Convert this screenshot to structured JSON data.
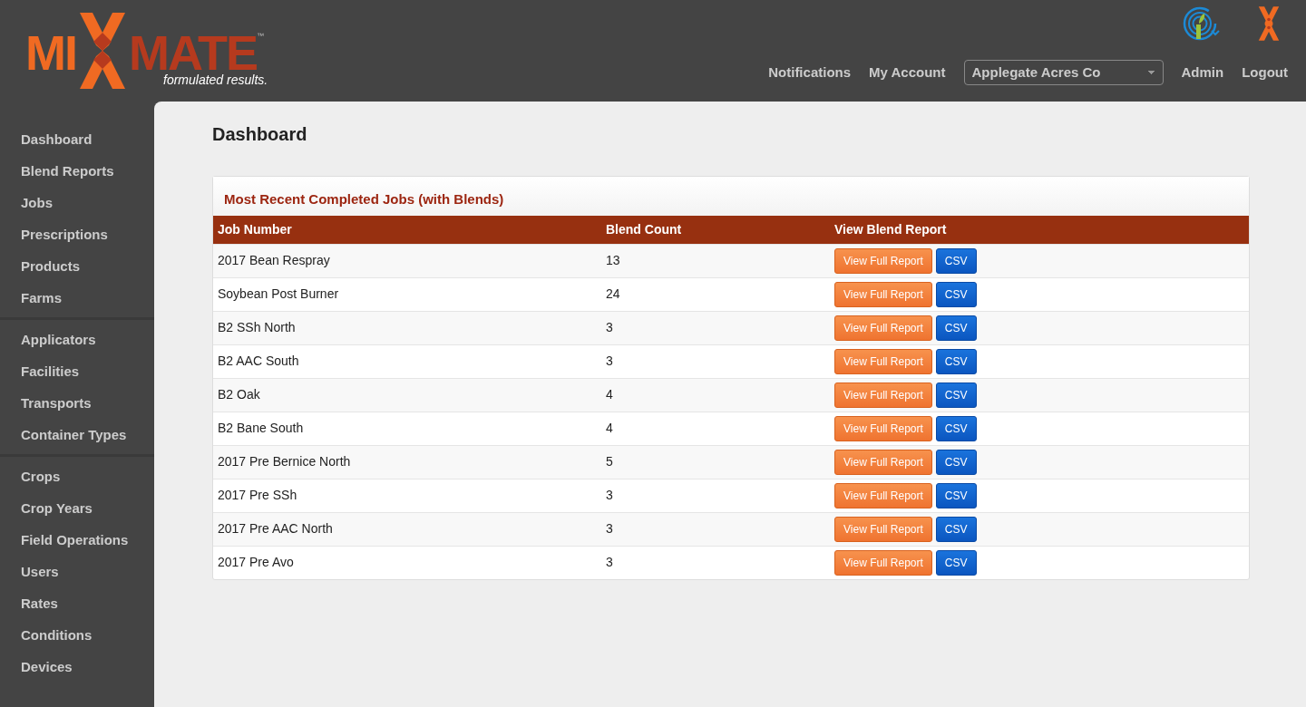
{
  "logo": {
    "left": "MI",
    "right": "MATE",
    "trademark": "™",
    "tagline": "formulated results."
  },
  "top_nav": {
    "links": [
      "Notifications",
      "My Account"
    ],
    "company_select": {
      "value": "Applegate Acres Co"
    },
    "right_links": [
      "Admin",
      "Logout"
    ]
  },
  "sidebar": {
    "groups": [
      [
        "Dashboard",
        "Blend Reports",
        "Jobs",
        "Prescriptions",
        "Products",
        "Farms"
      ],
      [
        "Applicators",
        "Facilities",
        "Transports",
        "Container Types"
      ],
      [
        "Crops",
        "Crop Years",
        "Field Operations",
        "Users",
        "Rates",
        "Conditions",
        "Devices"
      ]
    ]
  },
  "page_title": "Dashboard",
  "panel": {
    "title": "Most Recent Completed Jobs (with Blends)",
    "table": {
      "columns": [
        "Job Number",
        "Blend Count",
        "View Blend Report"
      ],
      "rows": [
        {
          "job": "2017 Bean Respray",
          "count": "13",
          "report_button": "View Full Report",
          "csv_button": "CSV"
        },
        {
          "job": "Soybean Post Burner",
          "count": "24",
          "report_button": "View Full Report",
          "csv_button": "CSV"
        },
        {
          "job": "B2 SSh North",
          "count": "3",
          "report_button": "View Full Report",
          "csv_button": "CSV"
        },
        {
          "job": "B2 AAC South",
          "count": "3",
          "report_button": "View Full Report",
          "csv_button": "CSV"
        },
        {
          "job": "B2 Oak",
          "count": "4",
          "report_button": "View Full Report",
          "csv_button": "CSV"
        },
        {
          "job": "B2 Bane South",
          "count": "4",
          "report_button": "View Full Report",
          "csv_button": "CSV"
        },
        {
          "job": "2017 Pre Bernice North",
          "count": "5",
          "report_button": "View Full Report",
          "csv_button": "CSV"
        },
        {
          "job": "2017 Pre SSh",
          "count": "3",
          "report_button": "View Full Report",
          "csv_button": "CSV"
        },
        {
          "job": "2017 Pre AAC North",
          "count": "3",
          "report_button": "View Full Report",
          "csv_button": "CSV"
        },
        {
          "job": "2017 Pre Avo",
          "count": "3",
          "report_button": "View Full Report",
          "csv_button": "CSV"
        }
      ]
    }
  }
}
